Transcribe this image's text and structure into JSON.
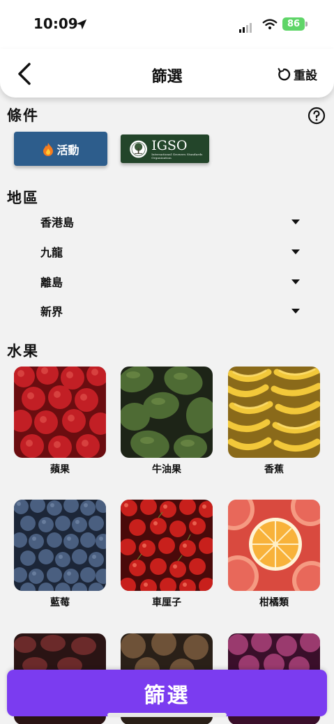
{
  "status_bar": {
    "time": "10:09",
    "battery": "86"
  },
  "header": {
    "title": "篩選",
    "reset_label": "重設"
  },
  "conditions": {
    "title": "條件",
    "activity_label": "活動",
    "igso": {
      "name": "IGSO",
      "subtitle": "International Growers Standards Organization"
    }
  },
  "region": {
    "title": "地區",
    "items": [
      "香港島",
      "九龍",
      "離島",
      "新界"
    ]
  },
  "fruits": {
    "title": "水果",
    "items": [
      "蘋果",
      "牛油果",
      "香蕉",
      "藍莓",
      "車厘子",
      "柑橘類"
    ]
  },
  "filter_button": "篩選",
  "colors": {
    "accent": "#7b3cf0",
    "activity_button": "#2d5d8c",
    "igso_badge": "#23452a",
    "battery": "#5fd568"
  }
}
